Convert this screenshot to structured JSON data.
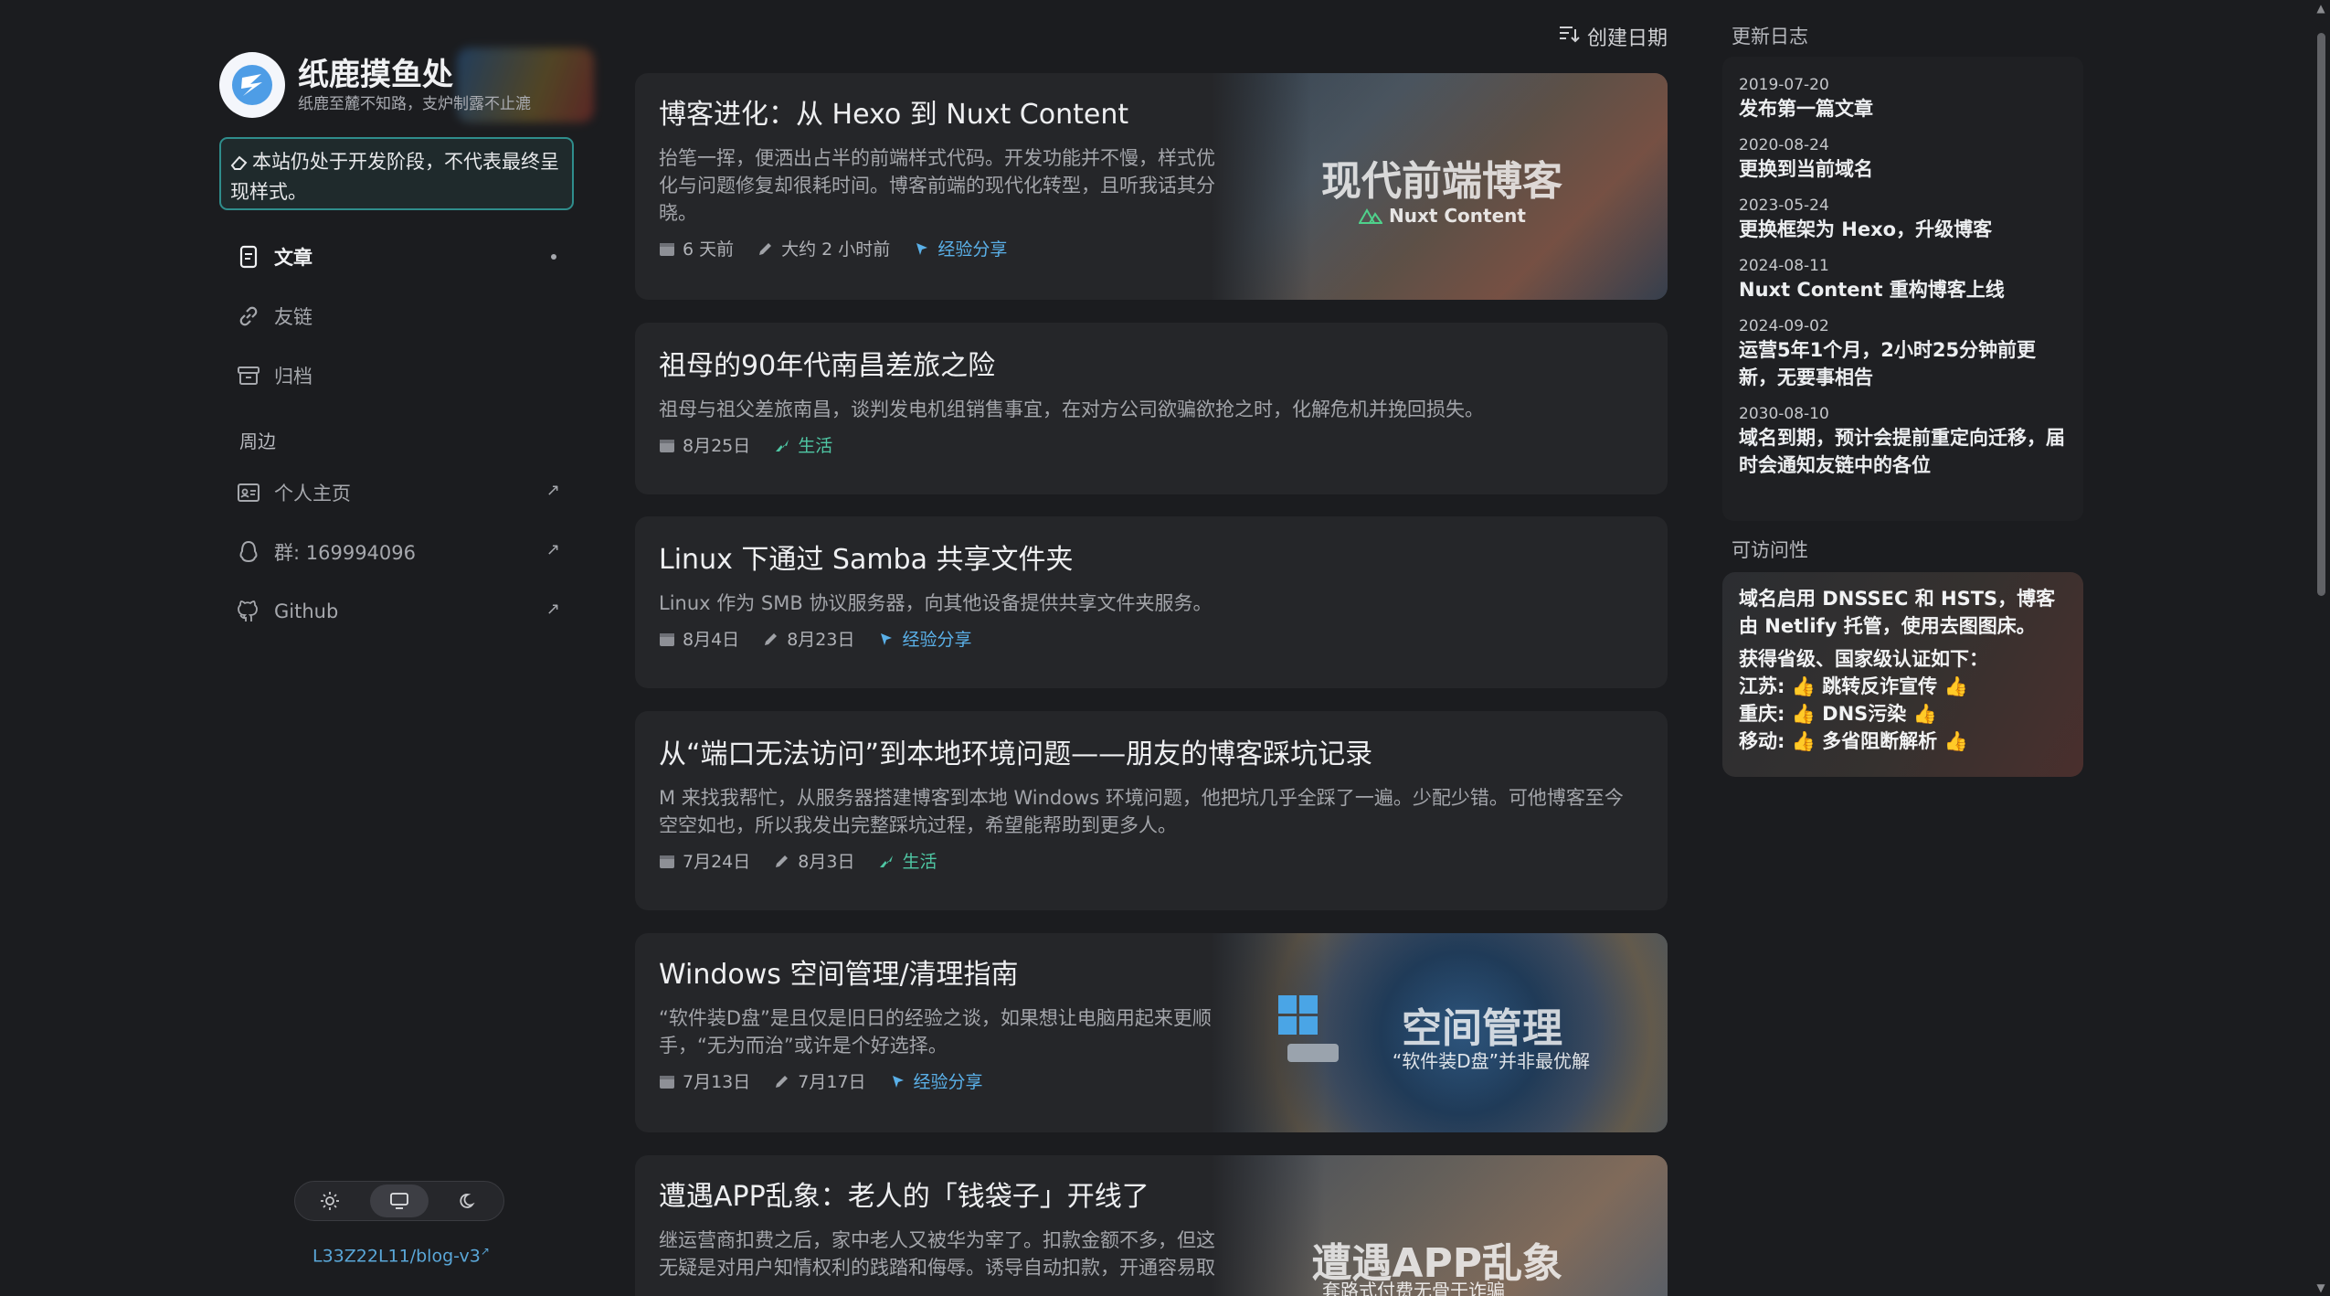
{
  "brand": {
    "title": "纸鹿摸鱼处",
    "subtitle": "纸鹿至麓不知路，支炉制露不止漉"
  },
  "notice": "本站仍处于开发阶段，不代表最终呈现样式。",
  "nav": {
    "items": [
      {
        "label": "文章",
        "icon": "article-icon",
        "active": true
      },
      {
        "label": "友链",
        "icon": "link-icon"
      },
      {
        "label": "归档",
        "icon": "archive-icon"
      }
    ],
    "section_label": "周边",
    "external": [
      {
        "label": "个人主页",
        "icon": "id-card-icon"
      },
      {
        "label": "群: 169994096",
        "icon": "qq-icon"
      },
      {
        "label": "Github",
        "icon": "github-icon"
      }
    ]
  },
  "footer": {
    "repo": "L33Z22L11/blog-v3",
    "theme_modes": [
      "light",
      "system",
      "dark"
    ],
    "theme_selected": "system"
  },
  "sort_label": "创建日期",
  "posts": [
    {
      "title": "博客进化：从 Hexo 到 Nuxt Content",
      "desc": "抬笔一挥，便洒出占半的前端样式代码。开发功能并不慢，样式优化与问题修复却很耗时间。博客前端的现代化转型，且听我话其分晓。",
      "created": "6 天前",
      "updated": "大约 2 小时前",
      "category": "经验分享",
      "cover_title": "现代前端博客",
      "cover_sub": "Nuxt Content"
    },
    {
      "title": "祖母的90年代南昌差旅之险",
      "desc": "祖母与祖父差旅南昌，谈判发电机组销售事宜，在对方公司欲骗欲抢之时，化解危机并挽回损失。",
      "created": "8月25日",
      "category": "生活"
    },
    {
      "title": "Linux 下通过 Samba 共享文件夹",
      "desc": "Linux 作为 SMB 协议服务器，向其他设备提供共享文件夹服务。",
      "created": "8月4日",
      "updated": "8月23日",
      "category": "经验分享"
    },
    {
      "title": "从“端口无法访问”到本地环境问题——朋友的博客踩坑记录",
      "desc": "M 来找我帮忙，从服务器搭建博客到本地 Windows 环境问题，他把坑几乎全踩了一遍。少配少错。可他博客至今空空如也，所以我发出完整踩坑过程，希望能帮助到更多人。",
      "created": "7月24日",
      "updated": "8月3日",
      "category": "生活"
    },
    {
      "title": "Windows 空间管理/清理指南",
      "desc": "“软件装D盘”是且仅是旧日的经验之谈，如果想让电脑用起来更顺手，“无为而治”或许是个好选择。",
      "created": "7月13日",
      "updated": "7月17日",
      "category": "经验分享",
      "cover_title": "空间管理",
      "cover_sub": "“软件装D盘”并非最优解"
    },
    {
      "title": "遭遇APP乱象：老人的「钱袋子」开线了",
      "desc": "继运营商扣费之后，家中老人又被华为宰了。扣款金额不多，但这无疑是对用户知情权利的践踏和侮辱。诱导自动扣款，开通容易取",
      "cover_title": "遭遇APP乱象",
      "cover_sub": "套路式付费无骨干诈骗"
    }
  ],
  "aside": {
    "changelog_title": "更新日志",
    "changelog": [
      {
        "date": "2019-07-20",
        "text": "发布第一篇文章"
      },
      {
        "date": "2020-08-24",
        "text": "更换到当前域名"
      },
      {
        "date": "2023-05-24",
        "text": "更换框架为 Hexo，升级博客"
      },
      {
        "date": "2024-08-11",
        "text": "Nuxt Content 重构博客上线"
      },
      {
        "date": "2024-09-02",
        "text": "运营5年1个月，2小时25分钟前更新，无要事相告"
      },
      {
        "date": "2030-08-10",
        "text": "域名到期，预计会提前重定向迁移，届时会通知友链中的各位"
      }
    ],
    "access_title": "可访问性",
    "access_lines": [
      "域名启用 DNSSEC 和 HSTS，博客由 Netlify 托管，使用去图图床。",
      "获得省级、国家级认证如下：",
      "江苏: 👍 跳转反诈宣传 👍",
      "重庆: 👍 DNS污染 👍",
      "移动: 👍 多省阻断解析 👍"
    ]
  },
  "colors": {
    "background": "#1b1c1f",
    "card": "#252629",
    "accent_blue": "#5ab0e8",
    "accent_green": "#4fc7a4",
    "notice_border": "#2f8d8c"
  }
}
